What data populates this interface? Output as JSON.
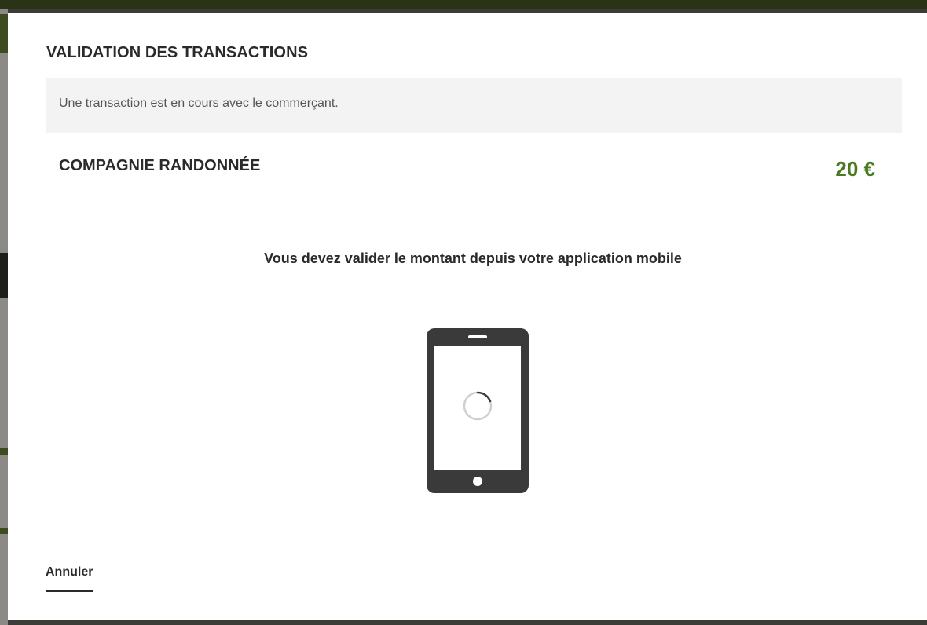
{
  "modal": {
    "title": "VALIDATION DES TRANSACTIONS",
    "info_message": "Une transaction est en cours avec le commerçant.",
    "merchant_name": "COMPAGNIE RANDONNÉE",
    "amount": "20 €",
    "instruction": "Vous devez valider le montant depuis votre application mobile",
    "phone_icon": "mobile-phone-icon",
    "spinner_icon": "loading-spinner-icon",
    "cancel_label": "Annuler"
  },
  "colors": {
    "amount": "#4a7a20",
    "text": "#2a2a2a",
    "banner_bg": "#f3f3f3",
    "phone": "#3a3a3a"
  }
}
